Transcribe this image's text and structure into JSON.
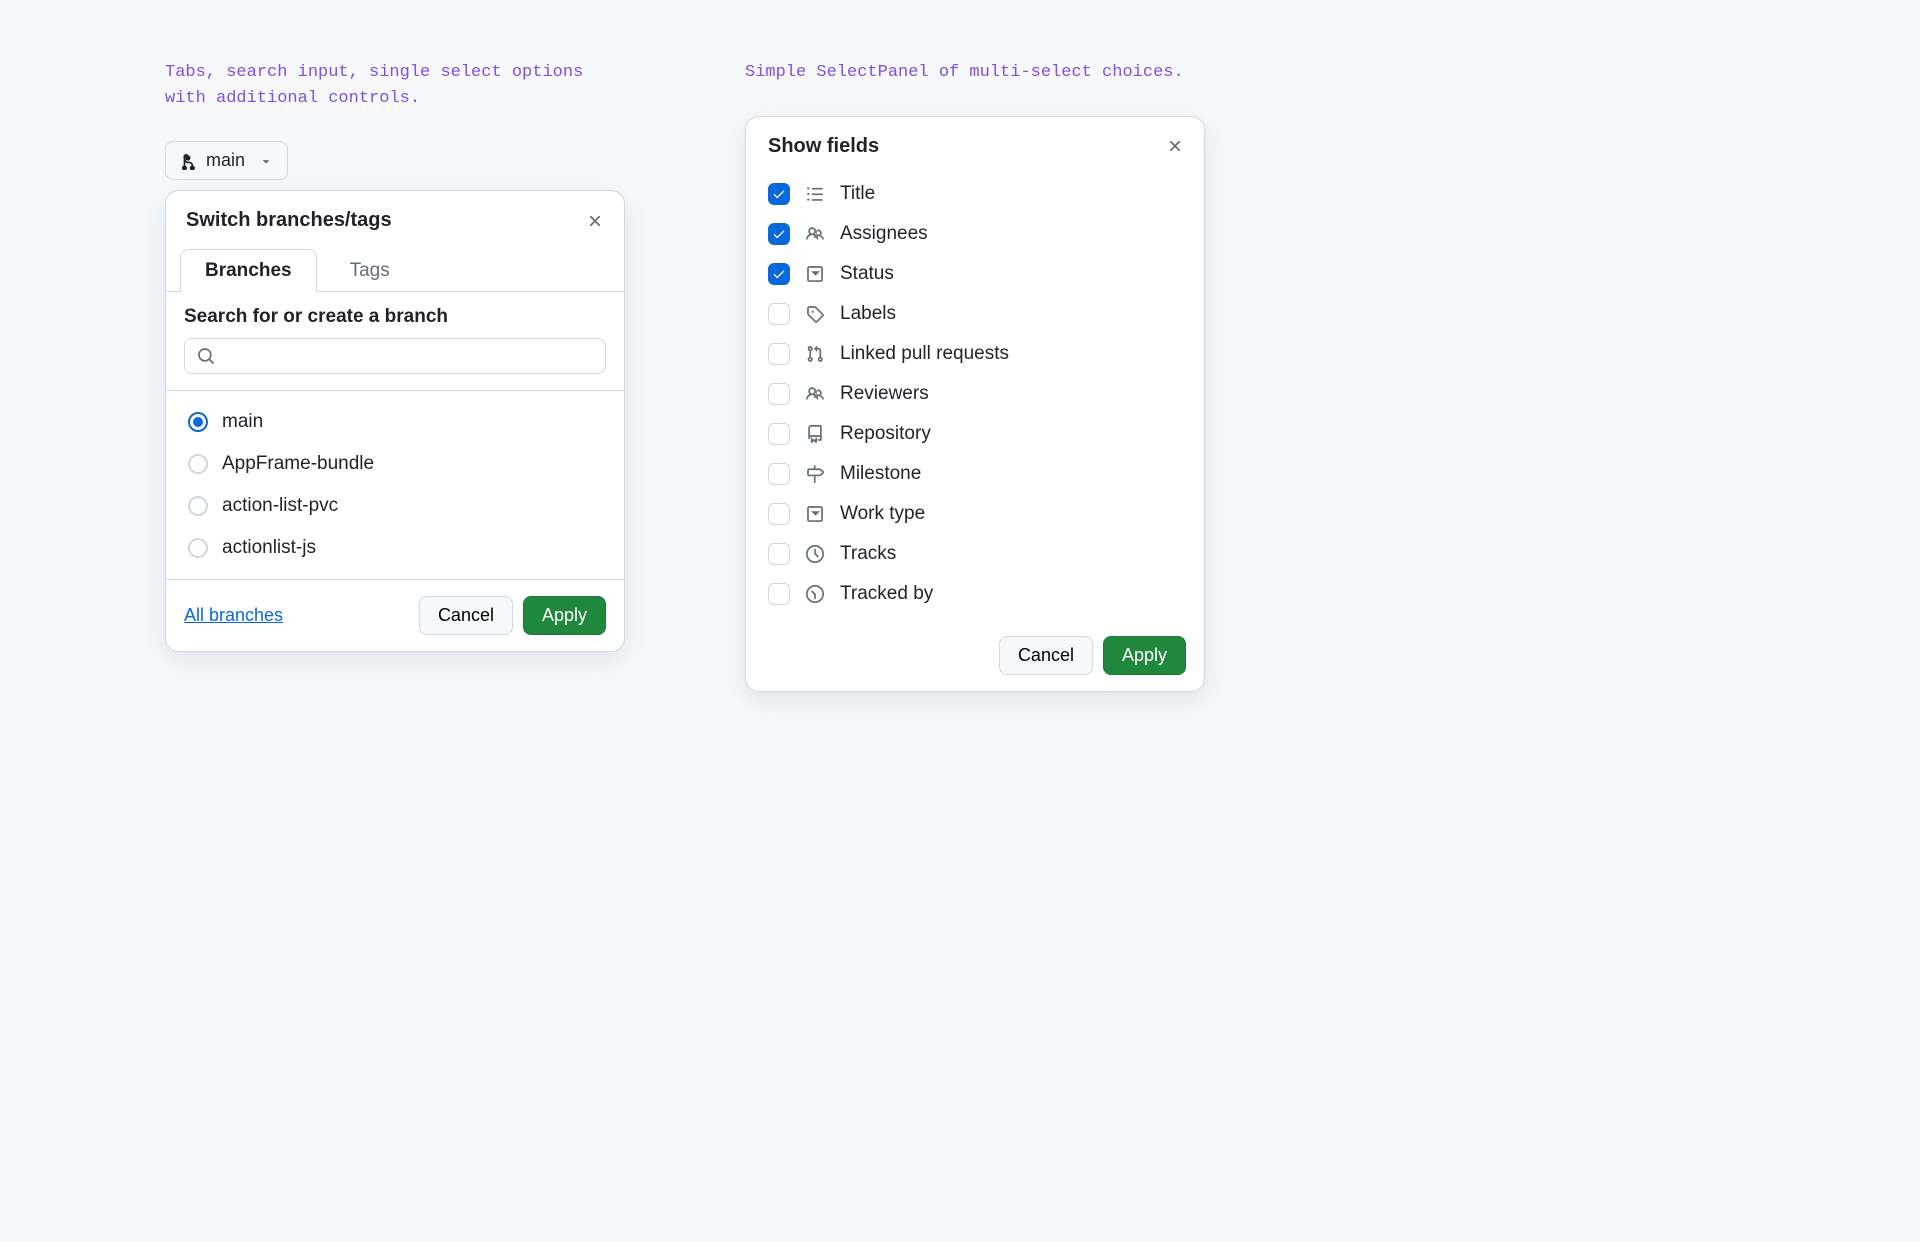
{
  "left": {
    "caption": "Tabs, search input, single select options with additional controls.",
    "trigger_label": "main",
    "panel_title": "Switch branches/tags",
    "tabs": [
      {
        "label": "Branches",
        "active": true
      },
      {
        "label": "Tags",
        "active": false
      }
    ],
    "search_label": "Search for or create a branch",
    "search_value": "",
    "branches": [
      {
        "label": "main",
        "selected": true
      },
      {
        "label": "AppFrame-bundle",
        "selected": false
      },
      {
        "label": "action-list-pvc",
        "selected": false
      },
      {
        "label": "actionlist-js",
        "selected": false
      }
    ],
    "all_branches_link": "All branches",
    "cancel_label": "Cancel",
    "apply_label": "Apply"
  },
  "right": {
    "caption": "Simple SelectPanel of multi-select choices.",
    "panel_title": "Show fields",
    "fields": [
      {
        "label": "Title",
        "checked": true,
        "icon": "list"
      },
      {
        "label": "Assignees",
        "checked": true,
        "icon": "people"
      },
      {
        "label": "Status",
        "checked": true,
        "icon": "select"
      },
      {
        "label": "Labels",
        "checked": false,
        "icon": "tag"
      },
      {
        "label": "Linked pull requests",
        "checked": false,
        "icon": "pull-request"
      },
      {
        "label": "Reviewers",
        "checked": false,
        "icon": "people"
      },
      {
        "label": "Repository",
        "checked": false,
        "icon": "repo"
      },
      {
        "label": "Milestone",
        "checked": false,
        "icon": "milestone"
      },
      {
        "label": "Work type",
        "checked": false,
        "icon": "select"
      },
      {
        "label": "Tracks",
        "checked": false,
        "icon": "tracks"
      },
      {
        "label": "Tracked by",
        "checked": false,
        "icon": "tracked-by"
      }
    ],
    "cancel_label": "Cancel",
    "apply_label": "Apply"
  }
}
